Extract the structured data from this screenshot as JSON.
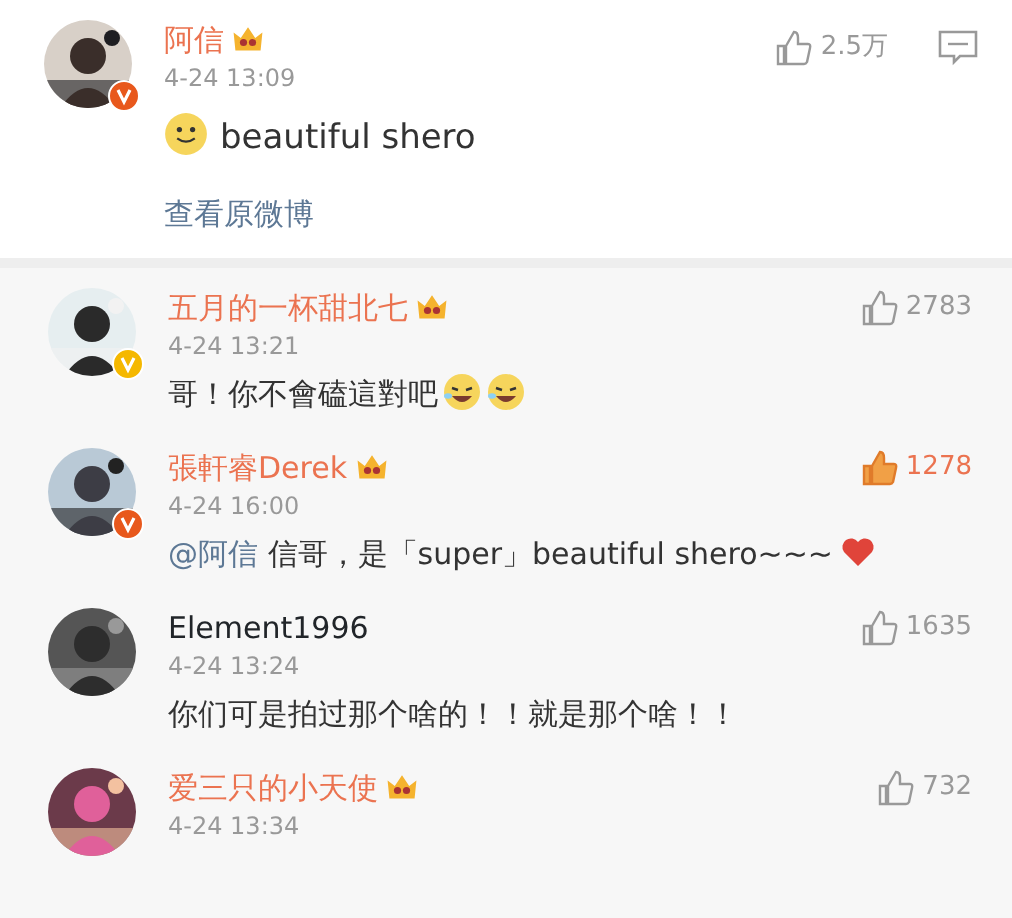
{
  "post": {
    "author": "阿信",
    "member": true,
    "verified": {
      "color": "#e8581c"
    },
    "time": "4-24 13:09",
    "likes": "2.5万",
    "liked": false,
    "leading_emoji": {
      "kind": "smile"
    },
    "text": "beautiful shero",
    "link": "查看原微博"
  },
  "comments": [
    {
      "author": "五月的一杯甜北七",
      "member": true,
      "verified": {
        "color": "#f5b800"
      },
      "time": "4-24 13:21",
      "likes": "2783",
      "liked": false,
      "text": "哥！你不會磕這對吧",
      "trailing_emojis": [
        {
          "kind": "laugh"
        },
        {
          "kind": "laugh"
        }
      ]
    },
    {
      "author": "張軒睿Derek",
      "member": true,
      "verified": {
        "color": "#e8581c"
      },
      "time": "4-24 16:00",
      "likes": "1278",
      "liked": true,
      "mention": "@阿信",
      "text": "信哥，是「super」beautiful shero~~~",
      "trailing_emojis": [
        {
          "kind": "heart"
        }
      ]
    },
    {
      "author": "Element1996",
      "member": false,
      "time": "4-24 13:24",
      "likes": "1635",
      "liked": false,
      "text": "你们可是拍过那个啥的！！就是那个啥！！"
    },
    {
      "author": "爱三只的小天使",
      "member": true,
      "time": "4-24 13:34",
      "likes": "732",
      "liked": false
    }
  ]
}
